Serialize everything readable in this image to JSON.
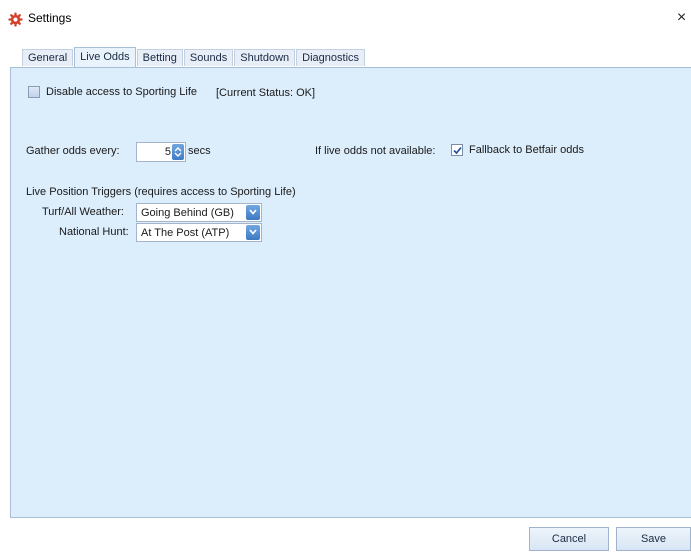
{
  "window": {
    "title": "Settings",
    "close_glyph": "×"
  },
  "tabs": [
    {
      "label": "General",
      "active": false
    },
    {
      "label": "Live Odds",
      "active": true
    },
    {
      "label": "Betting",
      "active": false
    },
    {
      "label": "Sounds",
      "active": false
    },
    {
      "label": "Shutdown",
      "active": false
    },
    {
      "label": "Diagnostics",
      "active": false
    }
  ],
  "live_odds": {
    "disable_access": {
      "label": "Disable access to Sporting Life",
      "checked": false
    },
    "current_status": "[Current Status: OK]",
    "gather_label": "Gather odds every:",
    "gather_value": "5",
    "gather_unit": "secs",
    "fallback_prompt": "If live odds not available:",
    "fallback": {
      "label": "Fallback to Betfair odds",
      "checked": true
    },
    "triggers_heading": "Live Position Triggers (requires access to Sporting Life)",
    "turf_label": "Turf/All Weather:",
    "turf_value": "Going Behind (GB)",
    "national_label": "National Hunt:",
    "national_value": "At The Post (ATP)"
  },
  "footer": {
    "cancel_label": "Cancel",
    "save_label": "Save"
  },
  "colors": {
    "panel_bg": "#dcedfb",
    "accent_blue": "#3f7bc6",
    "app_icon": "#d6402b"
  }
}
